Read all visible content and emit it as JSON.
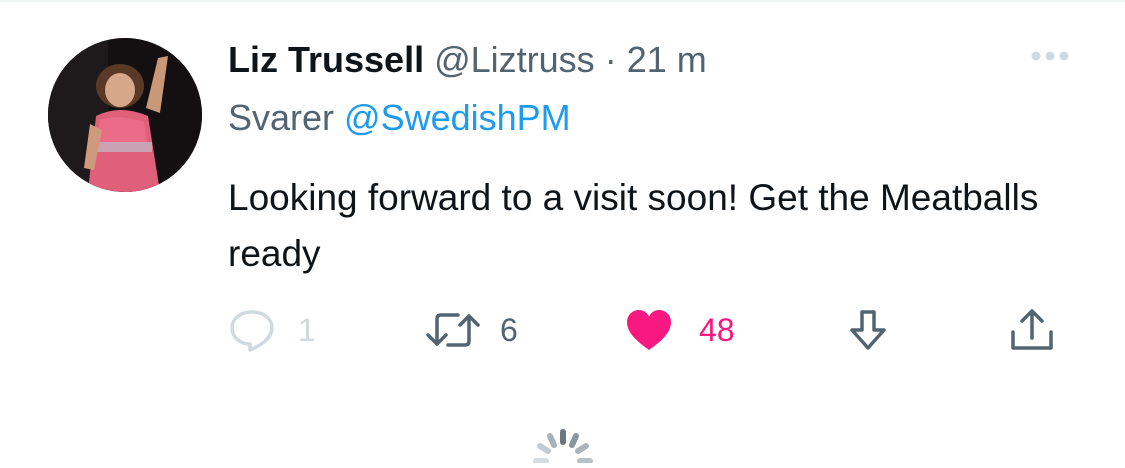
{
  "tweet": {
    "author_name": "Liz Trussell",
    "author_handle": "@Liztruss",
    "separator": "·",
    "time": "21 m",
    "reply_prefix": "Svarer",
    "reply_to": "@SwedishPM",
    "text": "Looking forward to a visit soon! Get the Meatballs ready"
  },
  "actions": {
    "reply_count": "1",
    "retweet_count": "6",
    "like_count": "48"
  },
  "icons": {
    "more": "more-horizontal-icon",
    "reply": "speech-bubble-icon",
    "retweet": "retweet-arrows-icon",
    "like": "heart-icon",
    "bookmark": "download-arrow-icon",
    "share": "share-upload-icon",
    "loading": "loading-spinner-icon"
  },
  "colors": {
    "accent": "#1d9bf0",
    "like": "#f91880",
    "secondary_text": "#536471",
    "disabled": "#cfd9de"
  }
}
